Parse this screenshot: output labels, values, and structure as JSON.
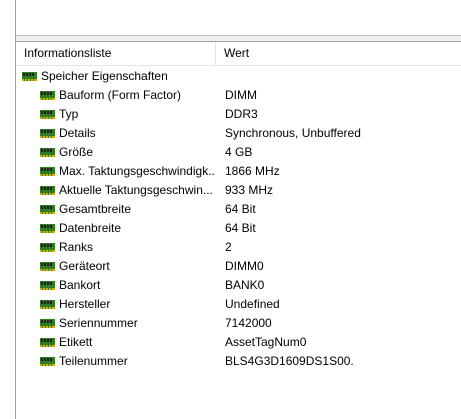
{
  "list": {
    "columns": {
      "name": "Informationsliste",
      "value": "Wert"
    },
    "group": {
      "label": "Speicher Eigenschaften",
      "icon": "ram-module-icon"
    },
    "items": [
      {
        "label": "Bauform (Form Factor)",
        "value": "DIMM",
        "icon": "ram-module-icon"
      },
      {
        "label": "Typ",
        "value": "DDR3",
        "icon": "ram-module-icon"
      },
      {
        "label": "Details",
        "value": "Synchronous, Unbuffered",
        "icon": "ram-module-icon"
      },
      {
        "label": "Größe",
        "value": "4 GB",
        "icon": "ram-module-icon"
      },
      {
        "label": "Max. Taktungsgeschwindigk...",
        "value": "1866 MHz",
        "icon": "ram-module-icon"
      },
      {
        "label": "Aktuelle Taktungsgeschwin...",
        "value": "933 MHz",
        "icon": "ram-module-icon"
      },
      {
        "label": "Gesamtbreite",
        "value": "64 Bit",
        "icon": "ram-module-icon"
      },
      {
        "label": "Datenbreite",
        "value": "64 Bit",
        "icon": "ram-module-icon"
      },
      {
        "label": "Ranks",
        "value": "2",
        "icon": "ram-module-icon"
      },
      {
        "label": "Geräteort",
        "value": "DIMM0",
        "icon": "ram-module-icon"
      },
      {
        "label": "Bankort",
        "value": "BANK0",
        "icon": "ram-module-icon"
      },
      {
        "label": "Hersteller",
        "value": "Undefined",
        "icon": "ram-module-icon"
      },
      {
        "label": "Seriennummer",
        "value": "7142000",
        "icon": "ram-module-icon"
      },
      {
        "label": "Etikett",
        "value": "AssetTagNum0",
        "icon": "ram-module-icon"
      },
      {
        "label": "Teilenummer",
        "value": "BLS4G3D1609DS1S00.",
        "icon": "ram-module-icon"
      }
    ]
  },
  "colors": {
    "ram_body": "#2e7d1f",
    "ram_chip": "#1f1f1f",
    "ram_pins": "#d4b000"
  }
}
